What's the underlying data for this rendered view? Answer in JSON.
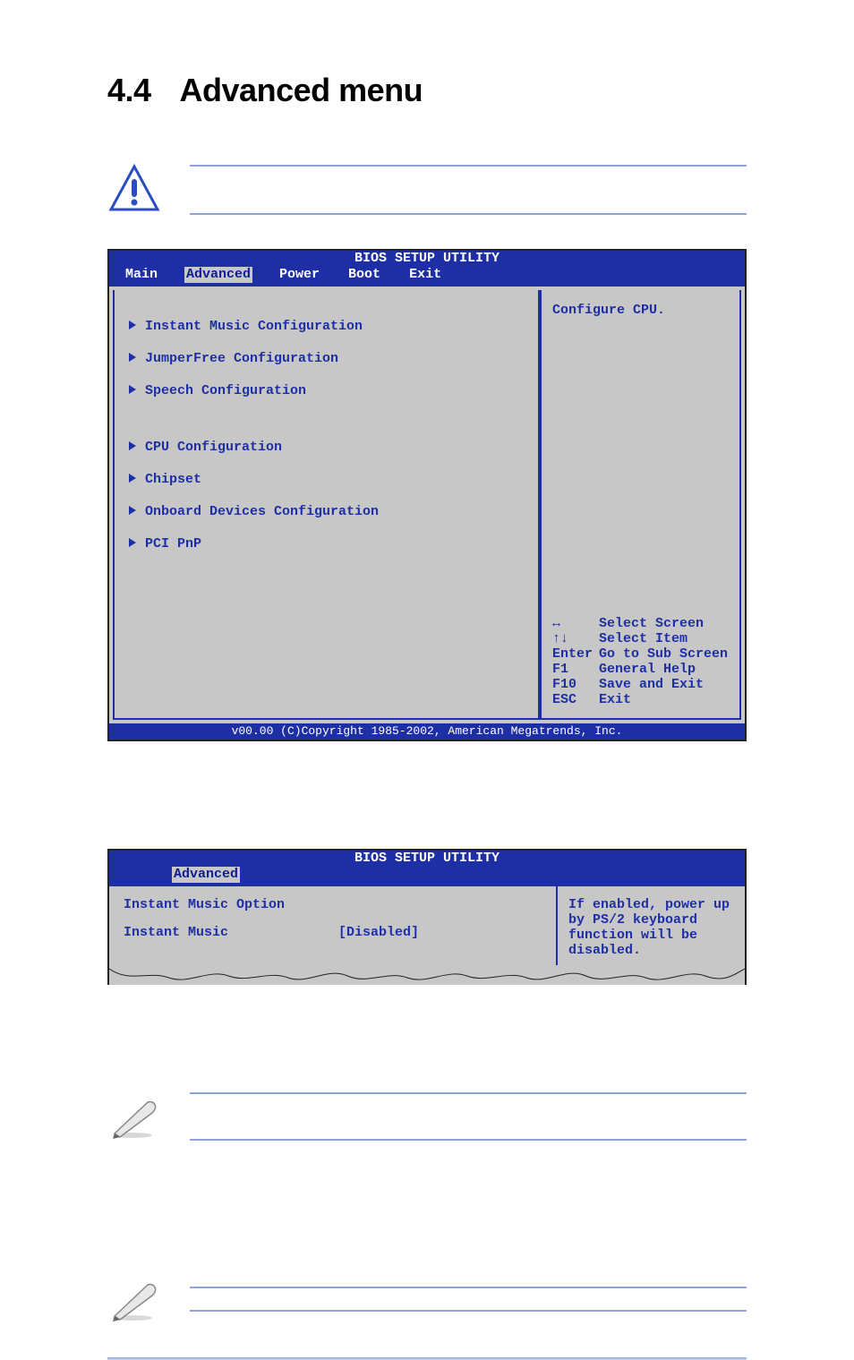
{
  "page": {
    "title_num": "4.4",
    "title_text": "Advanced menu"
  },
  "bios1": {
    "title": "BIOS SETUP UTILITY",
    "tabs": [
      "Main",
      "Advanced",
      "Power",
      "Boot",
      "Exit"
    ],
    "active_tab_index": 1,
    "menu_group1": [
      "Instant Music Configuration",
      "JumperFree Configuration",
      "Speech Configuration"
    ],
    "menu_group2": [
      "CPU Configuration",
      "Chipset",
      "Onboard Devices Configuration",
      "PCI PnP"
    ],
    "help_text": "Configure CPU.",
    "keys": [
      {
        "k": "↔",
        "d": "Select Screen"
      },
      {
        "k": "↑↓",
        "d": "Select Item"
      },
      {
        "k": "Enter",
        "d": "Go to Sub Screen"
      },
      {
        "k": "F1",
        "d": "General Help"
      },
      {
        "k": "F10",
        "d": "Save and Exit"
      },
      {
        "k": "ESC",
        "d": "Exit"
      }
    ],
    "footer": "v00.00 (C)Copyright 1985-2002, American Megatrends, Inc."
  },
  "bios2": {
    "title": "BIOS SETUP UTILITY",
    "active_tab": "Advanced",
    "heading": "Instant Music Option",
    "item_label": "Instant Music",
    "item_value": "[Disabled]",
    "help_text": "If enabled, power up by PS/2 keyboard function will be disabled."
  }
}
